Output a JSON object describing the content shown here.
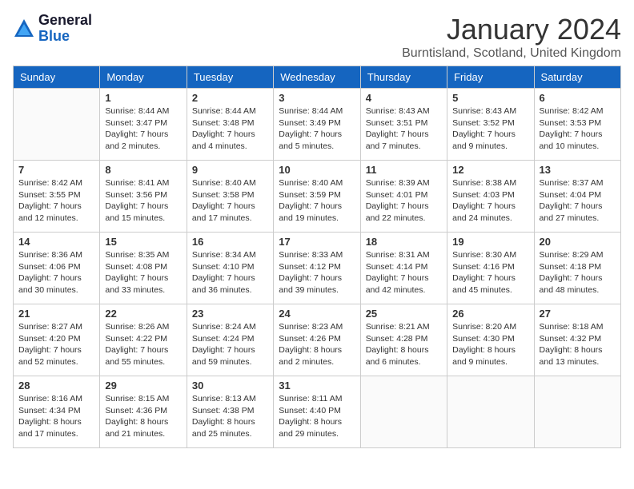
{
  "logo": {
    "general": "General",
    "blue": "Blue"
  },
  "title": "January 2024",
  "location": "Burntisland, Scotland, United Kingdom",
  "days_header": [
    "Sunday",
    "Monday",
    "Tuesday",
    "Wednesday",
    "Thursday",
    "Friday",
    "Saturday"
  ],
  "weeks": [
    [
      {
        "day": null,
        "content": null
      },
      {
        "day": "1",
        "sunrise": "Sunrise: 8:44 AM",
        "sunset": "Sunset: 3:47 PM",
        "daylight": "Daylight: 7 hours and 2 minutes."
      },
      {
        "day": "2",
        "sunrise": "Sunrise: 8:44 AM",
        "sunset": "Sunset: 3:48 PM",
        "daylight": "Daylight: 7 hours and 4 minutes."
      },
      {
        "day": "3",
        "sunrise": "Sunrise: 8:44 AM",
        "sunset": "Sunset: 3:49 PM",
        "daylight": "Daylight: 7 hours and 5 minutes."
      },
      {
        "day": "4",
        "sunrise": "Sunrise: 8:43 AM",
        "sunset": "Sunset: 3:51 PM",
        "daylight": "Daylight: 7 hours and 7 minutes."
      },
      {
        "day": "5",
        "sunrise": "Sunrise: 8:43 AM",
        "sunset": "Sunset: 3:52 PM",
        "daylight": "Daylight: 7 hours and 9 minutes."
      },
      {
        "day": "6",
        "sunrise": "Sunrise: 8:42 AM",
        "sunset": "Sunset: 3:53 PM",
        "daylight": "Daylight: 7 hours and 10 minutes."
      }
    ],
    [
      {
        "day": "7",
        "sunrise": "Sunrise: 8:42 AM",
        "sunset": "Sunset: 3:55 PM",
        "daylight": "Daylight: 7 hours and 12 minutes."
      },
      {
        "day": "8",
        "sunrise": "Sunrise: 8:41 AM",
        "sunset": "Sunset: 3:56 PM",
        "daylight": "Daylight: 7 hours and 15 minutes."
      },
      {
        "day": "9",
        "sunrise": "Sunrise: 8:40 AM",
        "sunset": "Sunset: 3:58 PM",
        "daylight": "Daylight: 7 hours and 17 minutes."
      },
      {
        "day": "10",
        "sunrise": "Sunrise: 8:40 AM",
        "sunset": "Sunset: 3:59 PM",
        "daylight": "Daylight: 7 hours and 19 minutes."
      },
      {
        "day": "11",
        "sunrise": "Sunrise: 8:39 AM",
        "sunset": "Sunset: 4:01 PM",
        "daylight": "Daylight: 7 hours and 22 minutes."
      },
      {
        "day": "12",
        "sunrise": "Sunrise: 8:38 AM",
        "sunset": "Sunset: 4:03 PM",
        "daylight": "Daylight: 7 hours and 24 minutes."
      },
      {
        "day": "13",
        "sunrise": "Sunrise: 8:37 AM",
        "sunset": "Sunset: 4:04 PM",
        "daylight": "Daylight: 7 hours and 27 minutes."
      }
    ],
    [
      {
        "day": "14",
        "sunrise": "Sunrise: 8:36 AM",
        "sunset": "Sunset: 4:06 PM",
        "daylight": "Daylight: 7 hours and 30 minutes."
      },
      {
        "day": "15",
        "sunrise": "Sunrise: 8:35 AM",
        "sunset": "Sunset: 4:08 PM",
        "daylight": "Daylight: 7 hours and 33 minutes."
      },
      {
        "day": "16",
        "sunrise": "Sunrise: 8:34 AM",
        "sunset": "Sunset: 4:10 PM",
        "daylight": "Daylight: 7 hours and 36 minutes."
      },
      {
        "day": "17",
        "sunrise": "Sunrise: 8:33 AM",
        "sunset": "Sunset: 4:12 PM",
        "daylight": "Daylight: 7 hours and 39 minutes."
      },
      {
        "day": "18",
        "sunrise": "Sunrise: 8:31 AM",
        "sunset": "Sunset: 4:14 PM",
        "daylight": "Daylight: 7 hours and 42 minutes."
      },
      {
        "day": "19",
        "sunrise": "Sunrise: 8:30 AM",
        "sunset": "Sunset: 4:16 PM",
        "daylight": "Daylight: 7 hours and 45 minutes."
      },
      {
        "day": "20",
        "sunrise": "Sunrise: 8:29 AM",
        "sunset": "Sunset: 4:18 PM",
        "daylight": "Daylight: 7 hours and 48 minutes."
      }
    ],
    [
      {
        "day": "21",
        "sunrise": "Sunrise: 8:27 AM",
        "sunset": "Sunset: 4:20 PM",
        "daylight": "Daylight: 7 hours and 52 minutes."
      },
      {
        "day": "22",
        "sunrise": "Sunrise: 8:26 AM",
        "sunset": "Sunset: 4:22 PM",
        "daylight": "Daylight: 7 hours and 55 minutes."
      },
      {
        "day": "23",
        "sunrise": "Sunrise: 8:24 AM",
        "sunset": "Sunset: 4:24 PM",
        "daylight": "Daylight: 7 hours and 59 minutes."
      },
      {
        "day": "24",
        "sunrise": "Sunrise: 8:23 AM",
        "sunset": "Sunset: 4:26 PM",
        "daylight": "Daylight: 8 hours and 2 minutes."
      },
      {
        "day": "25",
        "sunrise": "Sunrise: 8:21 AM",
        "sunset": "Sunset: 4:28 PM",
        "daylight": "Daylight: 8 hours and 6 minutes."
      },
      {
        "day": "26",
        "sunrise": "Sunrise: 8:20 AM",
        "sunset": "Sunset: 4:30 PM",
        "daylight": "Daylight: 8 hours and 9 minutes."
      },
      {
        "day": "27",
        "sunrise": "Sunrise: 8:18 AM",
        "sunset": "Sunset: 4:32 PM",
        "daylight": "Daylight: 8 hours and 13 minutes."
      }
    ],
    [
      {
        "day": "28",
        "sunrise": "Sunrise: 8:16 AM",
        "sunset": "Sunset: 4:34 PM",
        "daylight": "Daylight: 8 hours and 17 minutes."
      },
      {
        "day": "29",
        "sunrise": "Sunrise: 8:15 AM",
        "sunset": "Sunset: 4:36 PM",
        "daylight": "Daylight: 8 hours and 21 minutes."
      },
      {
        "day": "30",
        "sunrise": "Sunrise: 8:13 AM",
        "sunset": "Sunset: 4:38 PM",
        "daylight": "Daylight: 8 hours and 25 minutes."
      },
      {
        "day": "31",
        "sunrise": "Sunrise: 8:11 AM",
        "sunset": "Sunset: 4:40 PM",
        "daylight": "Daylight: 8 hours and 29 minutes."
      },
      {
        "day": null,
        "content": null
      },
      {
        "day": null,
        "content": null
      },
      {
        "day": null,
        "content": null
      }
    ]
  ]
}
